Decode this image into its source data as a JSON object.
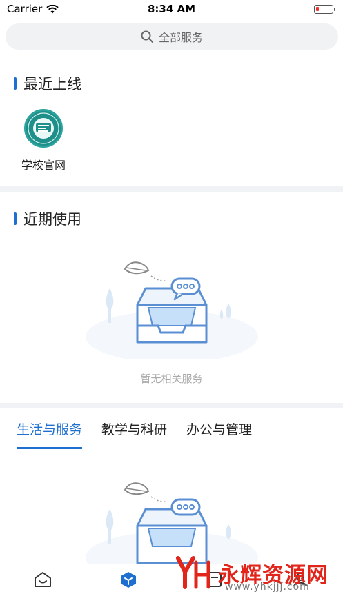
{
  "status_bar": {
    "carrier": "Carrier",
    "time": "8:34 AM"
  },
  "search": {
    "placeholder": "全部服务"
  },
  "recent_online": {
    "title": "最近上线",
    "apps": [
      {
        "label": "学校官网",
        "icon": "school-seal-icon"
      }
    ]
  },
  "recent_used": {
    "title": "近期使用",
    "empty_text": "暂无相关服务"
  },
  "category_tabs": [
    {
      "label": "生活与服务",
      "active": true
    },
    {
      "label": "教学与科研",
      "active": false
    },
    {
      "label": "办公与管理",
      "active": false
    }
  ],
  "bottom_tabs": [
    {
      "icon": "home-icon"
    },
    {
      "icon": "apps-cube-icon"
    },
    {
      "icon": "document-icon"
    },
    {
      "icon": "profile-icon"
    }
  ],
  "watermark": {
    "name": "永辉资源网",
    "url": "www.yhkjjj.com"
  },
  "colors": {
    "accent": "#1e6fd0",
    "divider": "#f1f2f6",
    "watermark": "#e1251b"
  }
}
